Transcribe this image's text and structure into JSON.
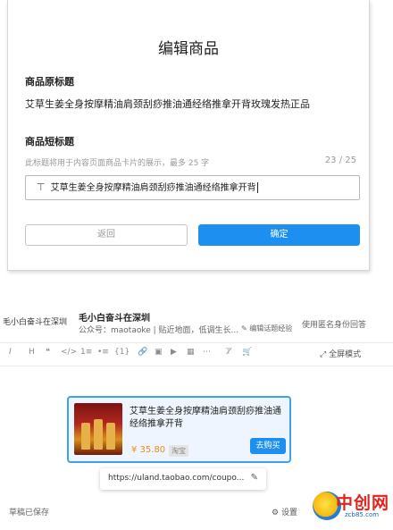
{
  "modal": {
    "title": "编辑商品",
    "original_title_label": "商品原标题",
    "original_title": "艾草生姜全身按摩精油肩颈刮痧推油通经络推拿开背玫瑰发热正品",
    "short_title_label": "商品短标题",
    "short_title_hint": "此标题将用于内容页面商品卡片的展示，最多 25 字",
    "short_title_counter": "23 / 25",
    "short_title_value": "艾草生姜全身按摩精油肩颈刮痧推油通经络推拿开背",
    "back_label": "返回",
    "confirm_label": "确定"
  },
  "editor": {
    "author_left": "毛小白奋斗在深圳",
    "author_name": "毛小白奋斗在深圳",
    "account_line": "公众号：maotaoke | 贴近地面，低调生长...",
    "edit_experience": "编辑话题经验",
    "anonymous_reply": "使用匿名身份回答",
    "fullscreen_label": "全屏模式",
    "toolbar": {
      "italic": "I",
      "heading": "H",
      "quote": "❝",
      "code": "</>",
      "ordered_list": "1≡",
      "unordered_list": "•≡",
      "formula": "{1}",
      "link": "🔗",
      "image": "▣",
      "video": "▶",
      "table": "▦",
      "more": "⋯",
      "clear_format": "⊤̸",
      "cart": "🛒"
    }
  },
  "product_card": {
    "title": "艾草生姜全身按摩精油肩颈刮痧推油通经络推拿开背",
    "price": "¥ 35.80",
    "store_tag": "淘宝",
    "buy_label": "去购买"
  },
  "link_popup": {
    "url": "https://uland.taobao.com/coupo..."
  },
  "footer": {
    "saved_status": "草稿已保存",
    "settings_label": "设置"
  },
  "watermark": {
    "text": "中创网",
    "sub": "zcb85.com"
  },
  "colors": {
    "primary": "#1d8ff0",
    "price": "#f0891c"
  }
}
